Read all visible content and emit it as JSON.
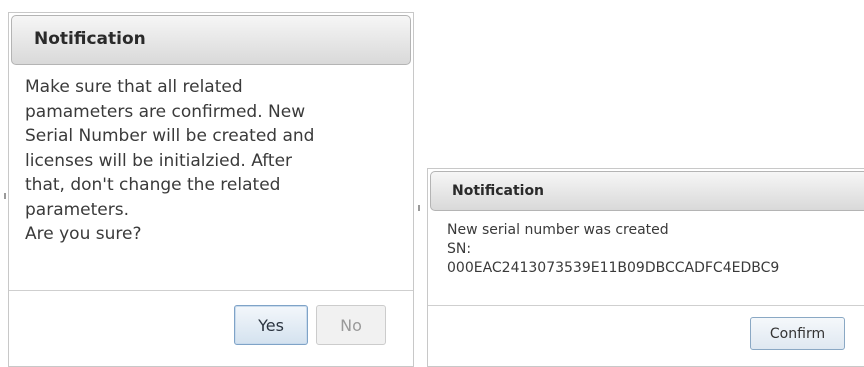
{
  "dialog_confirm": {
    "title": "Notification",
    "message_lines": [
      "Make sure that all related",
      "pamameters are confirmed. New",
      "Serial Number will be created and",
      "licenses will be initialzied. After",
      "that, don't change the related",
      "parameters.",
      "Are you sure?"
    ],
    "yes_label": "Yes",
    "no_label": "No"
  },
  "dialog_result": {
    "title": "Notification",
    "message_lines": [
      "New serial number was created",
      "SN:",
      "000EAC2413073539E11B09DBCCADFC4EDBC9"
    ],
    "confirm_label": "Confirm"
  },
  "colors": {
    "header_gradient_top": "#f6f6f6",
    "header_gradient_bottom": "#d9d9d9",
    "primary_button_border": "#7fa3c7",
    "disabled_text": "#9a9a9a"
  }
}
